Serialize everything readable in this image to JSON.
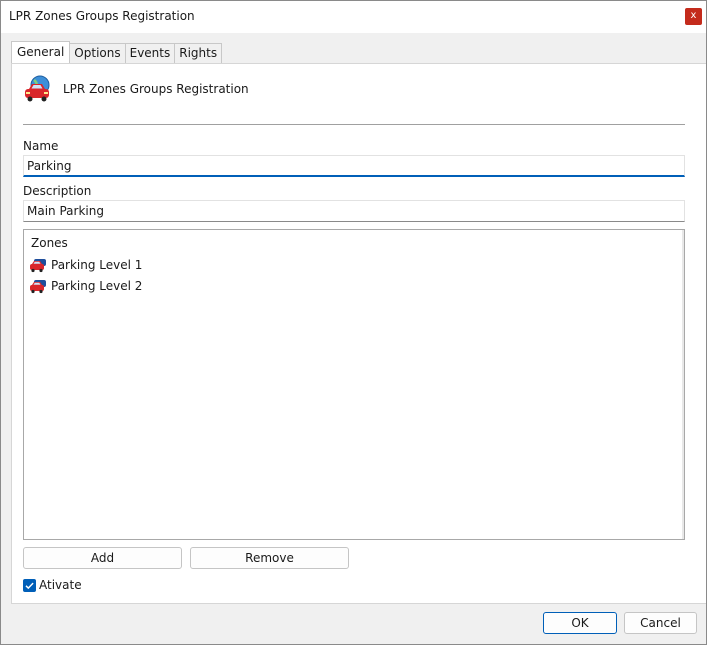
{
  "window": {
    "title": "LPR Zones Groups Registration",
    "close_label": "x"
  },
  "tabs": [
    {
      "label": "General",
      "active": true
    },
    {
      "label": "Options",
      "active": false
    },
    {
      "label": "Events",
      "active": false
    },
    {
      "label": "Rights",
      "active": false
    }
  ],
  "general": {
    "header_title": "LPR Zones Groups Registration",
    "header_icon": "car-globe-icon",
    "name_label": "Name",
    "name_value": "Parking",
    "description_label": "Description",
    "description_value": "Main Parking",
    "zones": {
      "header": "Zones",
      "items": [
        {
          "label": "Parking Level 1",
          "icon": "car-icon"
        },
        {
          "label": "Parking Level 2",
          "icon": "car-icon"
        }
      ]
    },
    "add_label": "Add",
    "remove_label": "Remove",
    "activate_label": "Ativate",
    "activate_checked": true
  },
  "footer": {
    "ok_label": "OK",
    "cancel_label": "Cancel"
  },
  "colors": {
    "accent": "#005fb8",
    "close": "#c42b1c",
    "car_red": "#d9262b",
    "car_blue": "#1f4e9c"
  }
}
